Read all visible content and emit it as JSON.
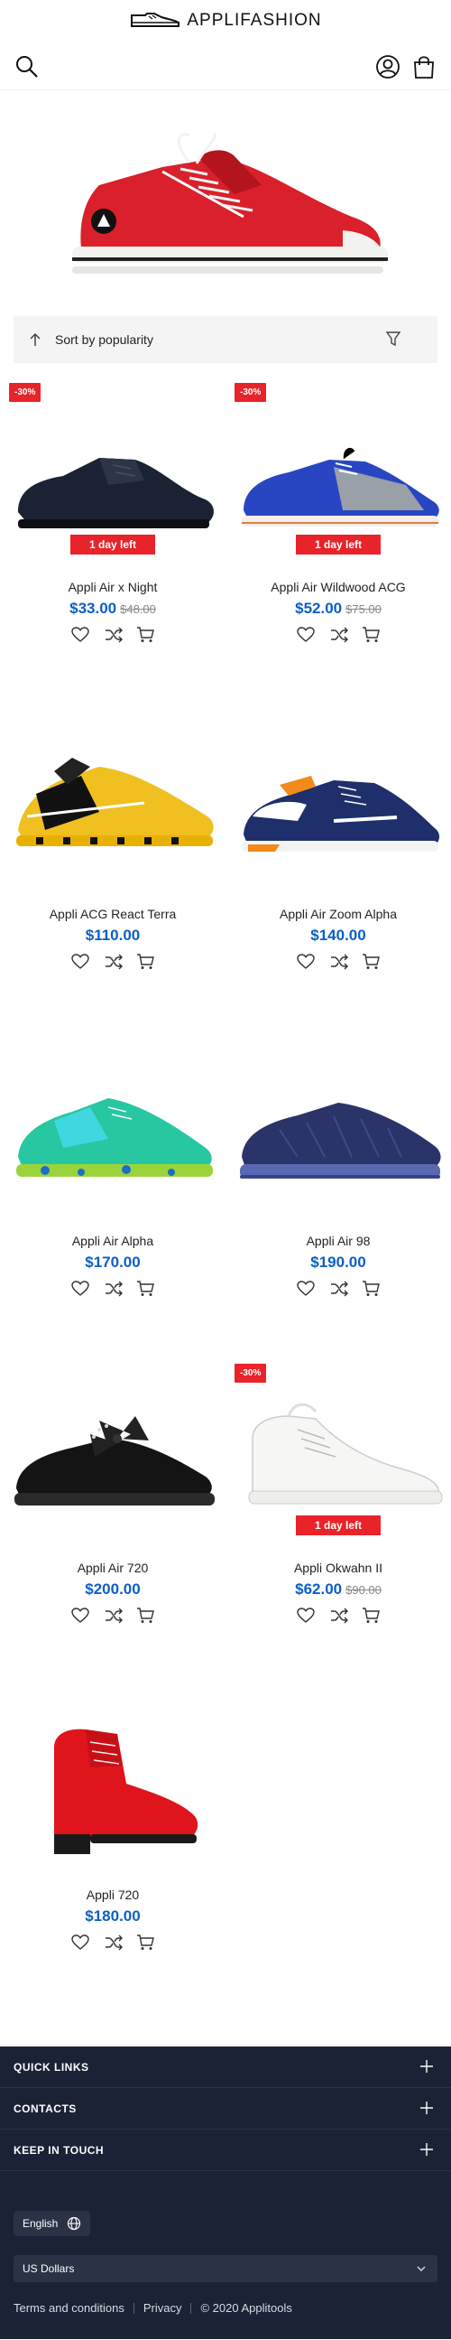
{
  "header": {
    "logo_text": "APPLIFASHION"
  },
  "sort": {
    "label": "Sort by popularity"
  },
  "products": [
    {
      "name": "Appli Air x Night",
      "price": "$33.00",
      "old_price": "$48.00",
      "badge": "-30%",
      "day_left": "1 day left",
      "image": "black-leather-shoe"
    },
    {
      "name": "Appli Air Wildwood ACG",
      "price": "$52.00",
      "old_price": "$75.00",
      "badge": "-30%",
      "day_left": "1 day left",
      "image": "blue-grey-sneaker"
    },
    {
      "name": "Appli ACG React Terra",
      "price": "$110.00",
      "old_price": "",
      "badge": "",
      "day_left": "",
      "image": "yellow-sock-sneaker"
    },
    {
      "name": "Appli Air Zoom Alpha",
      "price": "$140.00",
      "old_price": "",
      "badge": "",
      "day_left": "",
      "image": "navy-orange-sneaker"
    },
    {
      "name": "Appli Air Alpha",
      "price": "$170.00",
      "old_price": "",
      "badge": "",
      "day_left": "",
      "image": "green-knit-sneaker"
    },
    {
      "name": "Appli Air 98",
      "price": "$190.00",
      "old_price": "",
      "badge": "",
      "day_left": "",
      "image": "navy-knit-sneaker"
    },
    {
      "name": "Appli Air 720",
      "price": "$200.00",
      "old_price": "",
      "badge": "",
      "day_left": "",
      "image": "black-bow-sneaker"
    },
    {
      "name": "Appli Okwahn II",
      "price": "$62.00",
      "old_price": "$90.00",
      "badge": "-30%",
      "day_left": "1 day left",
      "image": "white-high-top"
    },
    {
      "name": "Appli 720",
      "price": "$180.00",
      "old_price": "",
      "badge": "",
      "day_left": "",
      "image": "red-ankle-boot"
    }
  ],
  "footer": {
    "sections": [
      "QUICK LINKS",
      "CONTACTS",
      "KEEP IN TOUCH"
    ],
    "language": "English",
    "currency": "US Dollars",
    "links": [
      "Terms and conditions",
      "Privacy",
      "© 2020 Applitools"
    ]
  },
  "colors": {
    "price_blue": "#0b5fc7",
    "sale_red": "#e8232a",
    "footer_bg": "#1a2335"
  },
  "icons": [
    "shoe-logo-icon",
    "search-icon",
    "user-icon",
    "shopping-bag-icon",
    "sort-arrow-icon",
    "filter-icon",
    "heart-icon",
    "compare-icon",
    "cart-icon",
    "plus-icon",
    "globe-icon",
    "chevron-down-icon"
  ]
}
